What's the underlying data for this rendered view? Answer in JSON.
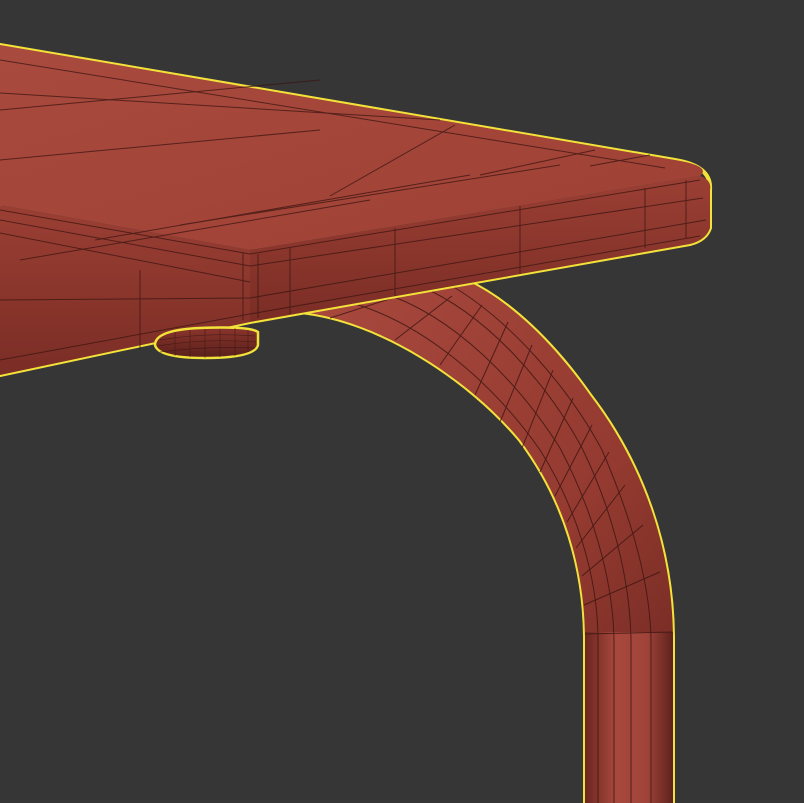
{
  "viewport": {
    "background_color": "#363636",
    "selection_outline_color": "#f2e23a",
    "model_base_color": "#a5463b",
    "model_dark_color": "#7e3129",
    "model_shadow_color": "#5e211c",
    "wireframe_color": "#3b1511",
    "selected": true
  }
}
